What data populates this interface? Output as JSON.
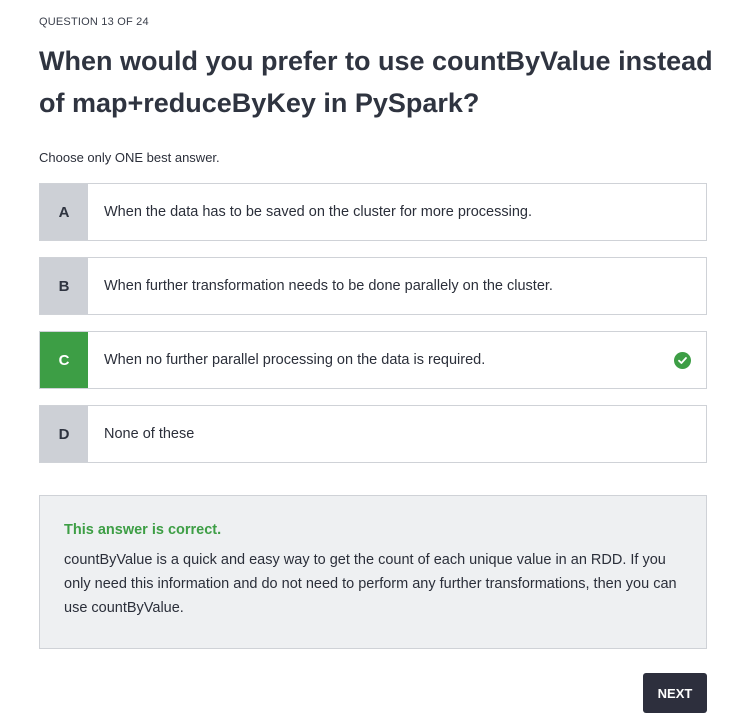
{
  "progress": "QUESTION 13 OF 24",
  "question": "When would you prefer to use countByValue instead of map+reduceByKey in PySpark?",
  "instruction": "Choose only ONE best answer.",
  "options": [
    {
      "letter": "A",
      "text": "When the data has to be saved on the cluster for more processing.",
      "selected": false
    },
    {
      "letter": "B",
      "text": "When further transformation needs to be done parallely on the cluster.",
      "selected": false
    },
    {
      "letter": "C",
      "text": "When no further parallel processing on the data is required.",
      "selected": true,
      "icon": "check-circle-icon"
    },
    {
      "letter": "D",
      "text": "None of these",
      "selected": false
    }
  ],
  "feedback": {
    "title": "This answer is correct.",
    "body": "countByValue is a quick and easy way to get the count of each unique value in an RDD. If you only need this information and do not need to perform any further transformations, then you can use countByValue."
  },
  "next_label": "NEXT",
  "colors": {
    "correct": "#3d9e45",
    "letter_bg": "#cdd0d6",
    "button_bg": "#2d2f3d"
  }
}
